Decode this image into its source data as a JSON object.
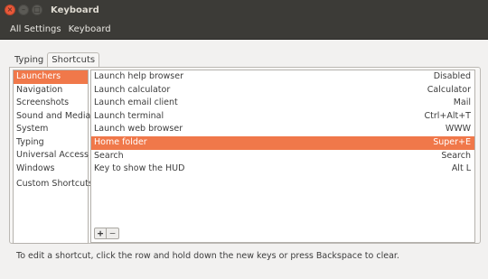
{
  "window": {
    "title": "Keyboard",
    "close_symbol": "×",
    "minimize_symbol": "–",
    "maximize_symbol": "□"
  },
  "toolbar": {
    "breadcrumbs": [
      "All Settings",
      "Keyboard"
    ]
  },
  "tabs": [
    {
      "label": "Typing",
      "active": false
    },
    {
      "label": "Shortcuts",
      "active": true
    }
  ],
  "categories": {
    "items": [
      "Launchers",
      "Navigation",
      "Screenshots",
      "Sound and Media",
      "System",
      "Typing",
      "Universal Access",
      "Windows"
    ],
    "custom": "Custom Shortcuts",
    "selected_index": 0
  },
  "shortcuts": {
    "rows": [
      {
        "action": "Launch help browser",
        "key": "Disabled"
      },
      {
        "action": "Launch calculator",
        "key": "Calculator"
      },
      {
        "action": "Launch email client",
        "key": "Mail"
      },
      {
        "action": "Launch terminal",
        "key": "Ctrl+Alt+T"
      },
      {
        "action": "Launch web browser",
        "key": "WWW"
      },
      {
        "action": "Home folder",
        "key": "Super+E"
      },
      {
        "action": "Search",
        "key": "Search"
      },
      {
        "action": "Key to show the HUD",
        "key": "Alt L"
      }
    ],
    "selected_index": 5
  },
  "list_buttons": {
    "add": "+",
    "remove": "−"
  },
  "hint": "To edit a shortcut, click the row and hold down the new keys or press Backspace to clear.",
  "colors": {
    "selection": "#f0784a",
    "titlebar": "#3c3b37",
    "close_button": "#e9593a"
  }
}
